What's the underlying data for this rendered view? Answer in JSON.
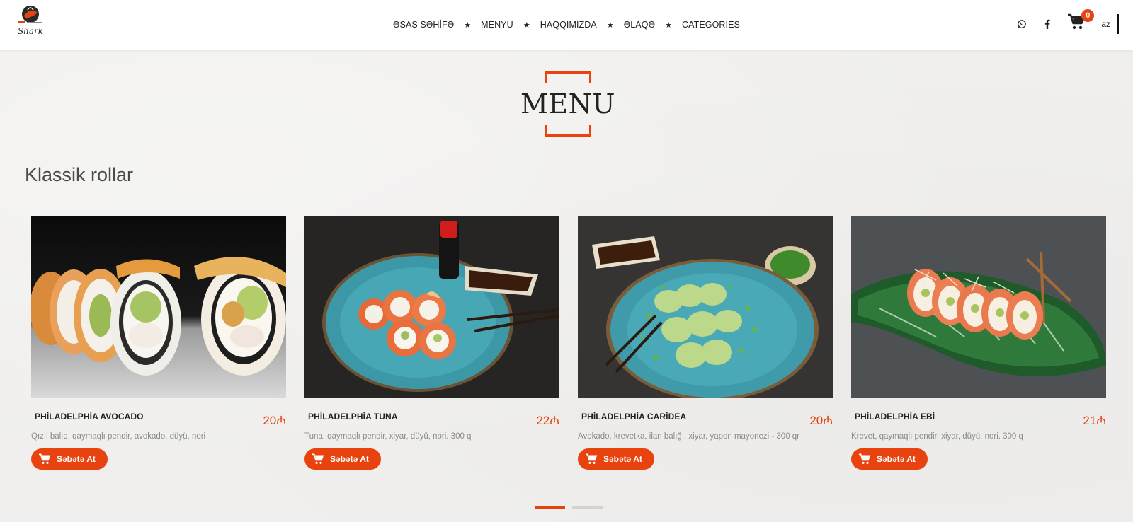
{
  "brand": {
    "logo_text": "Shark"
  },
  "nav": {
    "items": [
      {
        "label": "ƏSAS SƏHİFƏ"
      },
      {
        "label": "MENYU"
      },
      {
        "label": "HAQQIMIZDA"
      },
      {
        "label": "ƏLAQƏ"
      },
      {
        "label": "CATEGORIES"
      }
    ],
    "separator": "★"
  },
  "header": {
    "cart_count": "0",
    "language": "az",
    "icons": [
      "whatsapp-icon",
      "facebook-icon",
      "cart-icon"
    ]
  },
  "page": {
    "title": "MENU"
  },
  "section": {
    "title": "Klassik rollar"
  },
  "products": [
    {
      "name": "PHİLADELPHİA AVOCADO",
      "price": "20₼",
      "description": "Qızıl balıq, qaymaqlı pendir, avokado, düyü, nori",
      "button": "Səbətə At"
    },
    {
      "name": "PHİLADELPHİA TUNA",
      "price": "22₼",
      "description": "Tuna, qaymaqlı pendir, xiyar, düyü, nori. 300 q",
      "button": "Səbətə At"
    },
    {
      "name": "PHİLADELPHİA CARİDEA",
      "price": "20₼",
      "description": "Avokado, krevetka, ilan balığı, xiyar, yapon mayonezi - 300 qr",
      "button": "Səbətə At"
    },
    {
      "name": "PHİLADELPHİA EBİ",
      "price": "21₼",
      "description": "Krevet, qaymaqlı pendir, xiyar, düyü, nori. 300 q",
      "button": "Səbətə At"
    }
  ],
  "pager": {
    "pages": 2,
    "active": 1
  },
  "colors": {
    "accent": "#e8420f",
    "text": "#222222",
    "muted": "#8b8b8b",
    "background": "#f0efed"
  }
}
